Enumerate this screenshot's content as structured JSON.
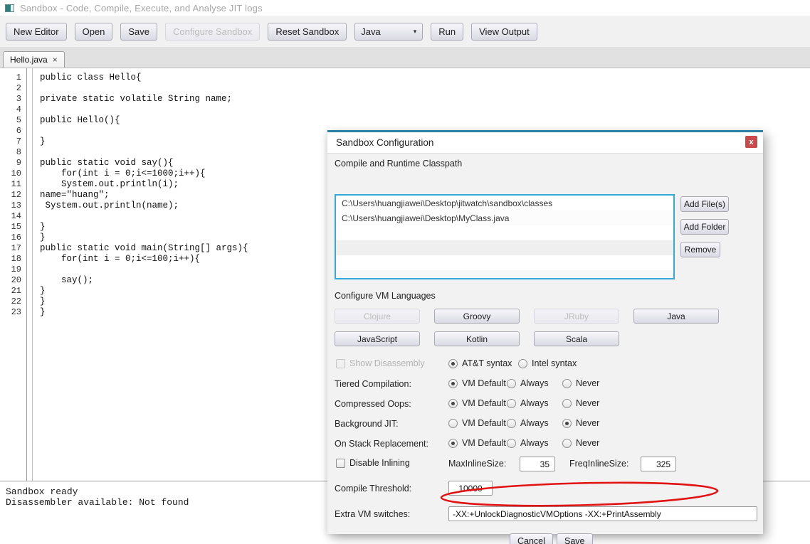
{
  "window": {
    "title": "Sandbox - Code, Compile, Execute, and Analyse JIT logs"
  },
  "icons": {
    "dropdown_arrow": "▾",
    "tab_close": "×",
    "dialog_close": "x"
  },
  "toolbar": {
    "new_editor": "New Editor",
    "open": "Open",
    "save": "Save",
    "configure_sandbox": {
      "label": "Configure Sandbox",
      "enabled": false
    },
    "reset_sandbox": "Reset Sandbox",
    "language_select": "Java",
    "run": "Run",
    "view_output": "View Output"
  },
  "tab": {
    "label": "Hello.java"
  },
  "editor": {
    "line_numbers": [
      1,
      2,
      3,
      4,
      5,
      6,
      7,
      8,
      9,
      10,
      11,
      12,
      13,
      14,
      15,
      16,
      17,
      18,
      19,
      20,
      21,
      22,
      23
    ],
    "lines": [
      "public class Hello{",
      "",
      "private static volatile String name;",
      "",
      "public Hello(){",
      "",
      "}",
      "",
      "public static void say(){",
      "    for(int i = 0;i<=1000;i++){",
      "    System.out.println(i);",
      "name=\"huang\";",
      " System.out.println(name);",
      "",
      "}",
      "}",
      "public static void main(String[] args){",
      "    for(int i = 0;i<=100;i++){",
      "",
      "    say();",
      "}",
      "}",
      "}"
    ]
  },
  "status": {
    "lines": [
      "Sandbox ready",
      "Disassembler available: Not found"
    ]
  },
  "dialog": {
    "title": "Sandbox Configuration",
    "classpath": {
      "label": "Compile and Runtime Classpath",
      "items": [
        "C:\\Users\\huangjiawei\\Desktop\\jitwatch\\sandbox\\classes",
        "C:\\Users\\huangjiawei\\Desktop\\MyClass.java"
      ],
      "add_files": "Add File(s)",
      "add_folder": "Add Folder",
      "remove": "Remove"
    },
    "languages": {
      "label": "Configure VM Languages",
      "buttons": [
        {
          "label": "Clojure",
          "enabled": false
        },
        {
          "label": "Groovy",
          "enabled": true
        },
        {
          "label": "JRuby",
          "enabled": false
        },
        {
          "label": "Java",
          "enabled": true
        },
        {
          "label": "JavaScript",
          "enabled": true
        },
        {
          "label": "Kotlin",
          "enabled": true
        },
        {
          "label": "Scala",
          "enabled": true
        }
      ]
    },
    "disassembly": {
      "label": "Show Disassembly",
      "checked": false,
      "enabled": false,
      "options": [
        {
          "label": "AT&T syntax",
          "selected": true
        },
        {
          "label": "Intel syntax",
          "selected": false
        }
      ]
    },
    "radio_rows": [
      {
        "label": "Tiered Compilation:",
        "options": [
          {
            "label": "VM Default",
            "selected": true
          },
          {
            "label": "Always",
            "selected": false
          },
          {
            "label": "Never",
            "selected": false
          }
        ]
      },
      {
        "label": "Compressed Oops:",
        "options": [
          {
            "label": "VM Default",
            "selected": true
          },
          {
            "label": "Always",
            "selected": false
          },
          {
            "label": "Never",
            "selected": false
          }
        ]
      },
      {
        "label": "Background JIT:",
        "options": [
          {
            "label": "VM Default",
            "selected": false
          },
          {
            "label": "Always",
            "selected": false
          },
          {
            "label": "Never",
            "selected": true
          }
        ]
      },
      {
        "label": "On Stack Replacement:",
        "options": [
          {
            "label": "VM Default",
            "selected": true
          },
          {
            "label": "Always",
            "selected": false
          },
          {
            "label": "Never",
            "selected": false
          }
        ]
      }
    ],
    "inlining": {
      "checkbox_label": "Disable Inlining",
      "checked": false,
      "max_label": "MaxInlineSize:",
      "max_value": "35",
      "freq_label": "FreqInlineSize:",
      "freq_value": "325"
    },
    "compile_threshold": {
      "label": "Compile Threshold:",
      "value": "10000"
    },
    "extra_switches": {
      "label": "Extra VM switches:",
      "value": "-XX:+UnlockDiagnosticVMOptions -XX:+PrintAssembly"
    },
    "cancel": "Cancel",
    "save": "Save"
  },
  "annotation": {
    "shape": "red-ellipse",
    "color": "#e01212"
  }
}
